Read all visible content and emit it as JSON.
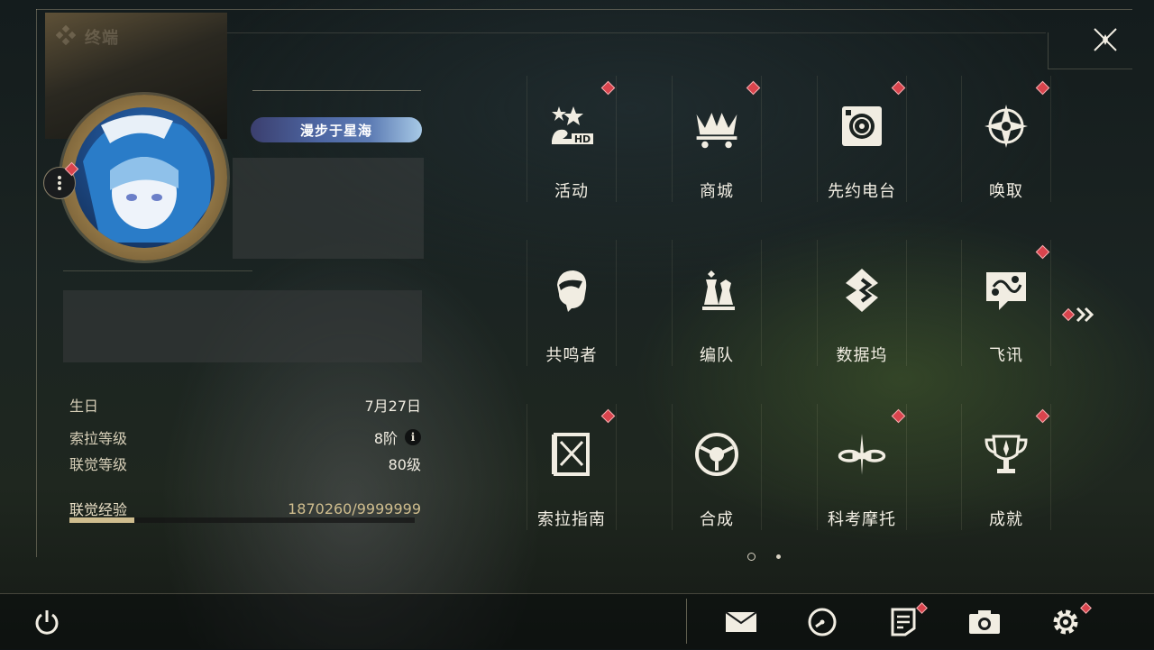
{
  "header": {
    "title": "终端"
  },
  "profile": {
    "badge_title": "漫步于星海"
  },
  "info": {
    "birthday_label": "生日",
    "birthday_value": "7月27日",
    "sola_level_label": "索拉等级",
    "sola_level_value": "8阶",
    "union_level_label": "联觉等级",
    "union_level_value": "80级",
    "union_exp_label": "联觉经验",
    "union_exp_value": "1870260/9999999",
    "union_exp_progress": 0.187
  },
  "menu": [
    {
      "label": "活动",
      "icon": "event-2hd-icon",
      "badge": true
    },
    {
      "label": "商城",
      "icon": "shop-cart-crown-icon",
      "badge": true
    },
    {
      "label": "先约电台",
      "icon": "radio-icon",
      "badge": true
    },
    {
      "label": "唤取",
      "icon": "convene-star-icon",
      "badge": true
    },
    {
      "label": "共鸣者",
      "icon": "resonator-portrait-icon",
      "badge": false
    },
    {
      "label": "编队",
      "icon": "team-chess-icon",
      "badge": false
    },
    {
      "label": "数据坞",
      "icon": "data-bank-icon",
      "badge": false
    },
    {
      "label": "飞讯",
      "icon": "message-icon",
      "badge": true
    },
    {
      "label": "索拉指南",
      "icon": "guide-book-icon",
      "badge": true
    },
    {
      "label": "合成",
      "icon": "synthesis-icon",
      "badge": false
    },
    {
      "label": "科考摩托",
      "icon": "motorbike-icon",
      "badge": true
    },
    {
      "label": "成就",
      "icon": "trophy-icon",
      "badge": true
    }
  ],
  "pagination": {
    "current": 1,
    "total": 2
  },
  "colors": {
    "accent": "#cfbd8e",
    "badge": "#d9444d",
    "text": "#f3efe4"
  },
  "bottom_bar": [
    "power-icon",
    "mail-icon",
    "clock-icon",
    "notice-icon",
    "camera-icon",
    "settings-icon"
  ]
}
